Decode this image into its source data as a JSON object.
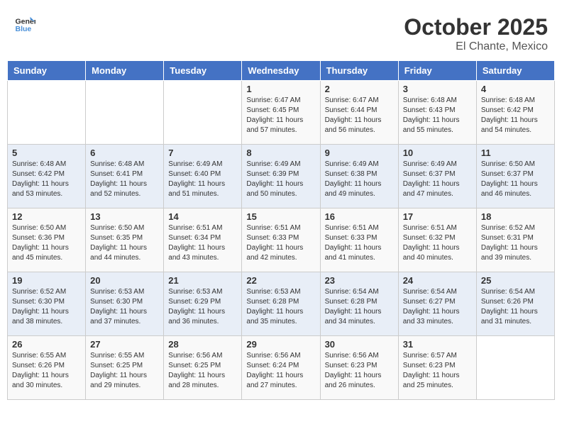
{
  "header": {
    "logo_line1": "General",
    "logo_line2": "Blue",
    "month": "October 2025",
    "location": "El Chante, Mexico"
  },
  "weekdays": [
    "Sunday",
    "Monday",
    "Tuesday",
    "Wednesday",
    "Thursday",
    "Friday",
    "Saturday"
  ],
  "weeks": [
    [
      {
        "day": "",
        "sunrise": "",
        "sunset": "",
        "daylight": ""
      },
      {
        "day": "",
        "sunrise": "",
        "sunset": "",
        "daylight": ""
      },
      {
        "day": "",
        "sunrise": "",
        "sunset": "",
        "daylight": ""
      },
      {
        "day": "1",
        "sunrise": "Sunrise: 6:47 AM",
        "sunset": "Sunset: 6:45 PM",
        "daylight": "Daylight: 11 hours and 57 minutes."
      },
      {
        "day": "2",
        "sunrise": "Sunrise: 6:47 AM",
        "sunset": "Sunset: 6:44 PM",
        "daylight": "Daylight: 11 hours and 56 minutes."
      },
      {
        "day": "3",
        "sunrise": "Sunrise: 6:48 AM",
        "sunset": "Sunset: 6:43 PM",
        "daylight": "Daylight: 11 hours and 55 minutes."
      },
      {
        "day": "4",
        "sunrise": "Sunrise: 6:48 AM",
        "sunset": "Sunset: 6:42 PM",
        "daylight": "Daylight: 11 hours and 54 minutes."
      }
    ],
    [
      {
        "day": "5",
        "sunrise": "Sunrise: 6:48 AM",
        "sunset": "Sunset: 6:42 PM",
        "daylight": "Daylight: 11 hours and 53 minutes."
      },
      {
        "day": "6",
        "sunrise": "Sunrise: 6:48 AM",
        "sunset": "Sunset: 6:41 PM",
        "daylight": "Daylight: 11 hours and 52 minutes."
      },
      {
        "day": "7",
        "sunrise": "Sunrise: 6:49 AM",
        "sunset": "Sunset: 6:40 PM",
        "daylight": "Daylight: 11 hours and 51 minutes."
      },
      {
        "day": "8",
        "sunrise": "Sunrise: 6:49 AM",
        "sunset": "Sunset: 6:39 PM",
        "daylight": "Daylight: 11 hours and 50 minutes."
      },
      {
        "day": "9",
        "sunrise": "Sunrise: 6:49 AM",
        "sunset": "Sunset: 6:38 PM",
        "daylight": "Daylight: 11 hours and 49 minutes."
      },
      {
        "day": "10",
        "sunrise": "Sunrise: 6:49 AM",
        "sunset": "Sunset: 6:37 PM",
        "daylight": "Daylight: 11 hours and 47 minutes."
      },
      {
        "day": "11",
        "sunrise": "Sunrise: 6:50 AM",
        "sunset": "Sunset: 6:37 PM",
        "daylight": "Daylight: 11 hours and 46 minutes."
      }
    ],
    [
      {
        "day": "12",
        "sunrise": "Sunrise: 6:50 AM",
        "sunset": "Sunset: 6:36 PM",
        "daylight": "Daylight: 11 hours and 45 minutes."
      },
      {
        "day": "13",
        "sunrise": "Sunrise: 6:50 AM",
        "sunset": "Sunset: 6:35 PM",
        "daylight": "Daylight: 11 hours and 44 minutes."
      },
      {
        "day": "14",
        "sunrise": "Sunrise: 6:51 AM",
        "sunset": "Sunset: 6:34 PM",
        "daylight": "Daylight: 11 hours and 43 minutes."
      },
      {
        "day": "15",
        "sunrise": "Sunrise: 6:51 AM",
        "sunset": "Sunset: 6:33 PM",
        "daylight": "Daylight: 11 hours and 42 minutes."
      },
      {
        "day": "16",
        "sunrise": "Sunrise: 6:51 AM",
        "sunset": "Sunset: 6:33 PM",
        "daylight": "Daylight: 11 hours and 41 minutes."
      },
      {
        "day": "17",
        "sunrise": "Sunrise: 6:51 AM",
        "sunset": "Sunset: 6:32 PM",
        "daylight": "Daylight: 11 hours and 40 minutes."
      },
      {
        "day": "18",
        "sunrise": "Sunrise: 6:52 AM",
        "sunset": "Sunset: 6:31 PM",
        "daylight": "Daylight: 11 hours and 39 minutes."
      }
    ],
    [
      {
        "day": "19",
        "sunrise": "Sunrise: 6:52 AM",
        "sunset": "Sunset: 6:30 PM",
        "daylight": "Daylight: 11 hours and 38 minutes."
      },
      {
        "day": "20",
        "sunrise": "Sunrise: 6:53 AM",
        "sunset": "Sunset: 6:30 PM",
        "daylight": "Daylight: 11 hours and 37 minutes."
      },
      {
        "day": "21",
        "sunrise": "Sunrise: 6:53 AM",
        "sunset": "Sunset: 6:29 PM",
        "daylight": "Daylight: 11 hours and 36 minutes."
      },
      {
        "day": "22",
        "sunrise": "Sunrise: 6:53 AM",
        "sunset": "Sunset: 6:28 PM",
        "daylight": "Daylight: 11 hours and 35 minutes."
      },
      {
        "day": "23",
        "sunrise": "Sunrise: 6:54 AM",
        "sunset": "Sunset: 6:28 PM",
        "daylight": "Daylight: 11 hours and 34 minutes."
      },
      {
        "day": "24",
        "sunrise": "Sunrise: 6:54 AM",
        "sunset": "Sunset: 6:27 PM",
        "daylight": "Daylight: 11 hours and 33 minutes."
      },
      {
        "day": "25",
        "sunrise": "Sunrise: 6:54 AM",
        "sunset": "Sunset: 6:26 PM",
        "daylight": "Daylight: 11 hours and 31 minutes."
      }
    ],
    [
      {
        "day": "26",
        "sunrise": "Sunrise: 6:55 AM",
        "sunset": "Sunset: 6:26 PM",
        "daylight": "Daylight: 11 hours and 30 minutes."
      },
      {
        "day": "27",
        "sunrise": "Sunrise: 6:55 AM",
        "sunset": "Sunset: 6:25 PM",
        "daylight": "Daylight: 11 hours and 29 minutes."
      },
      {
        "day": "28",
        "sunrise": "Sunrise: 6:56 AM",
        "sunset": "Sunset: 6:25 PM",
        "daylight": "Daylight: 11 hours and 28 minutes."
      },
      {
        "day": "29",
        "sunrise": "Sunrise: 6:56 AM",
        "sunset": "Sunset: 6:24 PM",
        "daylight": "Daylight: 11 hours and 27 minutes."
      },
      {
        "day": "30",
        "sunrise": "Sunrise: 6:56 AM",
        "sunset": "Sunset: 6:23 PM",
        "daylight": "Daylight: 11 hours and 26 minutes."
      },
      {
        "day": "31",
        "sunrise": "Sunrise: 6:57 AM",
        "sunset": "Sunset: 6:23 PM",
        "daylight": "Daylight: 11 hours and 25 minutes."
      },
      {
        "day": "",
        "sunrise": "",
        "sunset": "",
        "daylight": ""
      }
    ]
  ]
}
